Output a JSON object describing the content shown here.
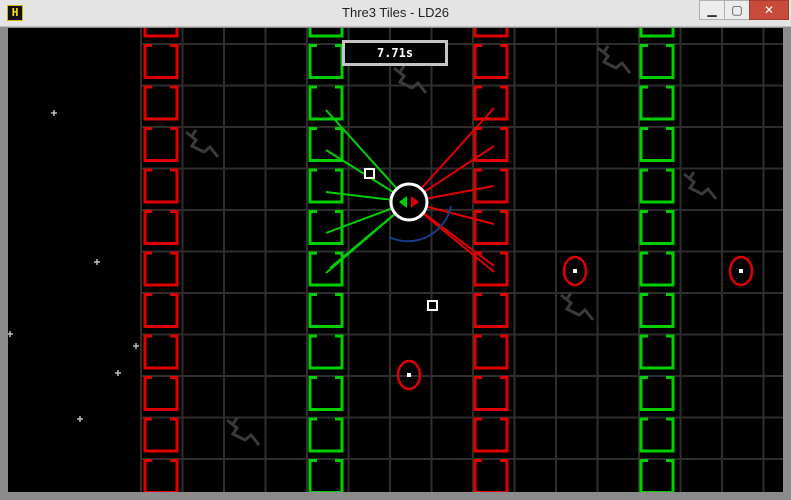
{
  "window": {
    "title": "Thre3 Tiles - LD26",
    "icon": "game-logo-icon",
    "icon_glyph": "H",
    "minimize_glyph": "▁",
    "maximize_glyph": "▢",
    "close_glyph": "✕"
  },
  "hud": {
    "timer": "7.71s"
  },
  "colors": {
    "background": "#000000",
    "grid": "#2e2e2e",
    "red_wall": "#e00000",
    "green_wall": "#00d000",
    "player": "#ffffff",
    "aim_arc": "#1a3a8a",
    "enemy_ring": "#e00000",
    "pickup": "#ffffff",
    "debris": "#3a3a3a",
    "timer_border": "#c4c4c4"
  },
  "columns": [
    {
      "name": "red-tile-column",
      "color": "red"
    },
    {
      "name": "green-tile-column",
      "color": "green"
    },
    {
      "name": "red-tile-column",
      "color": "red"
    },
    {
      "name": "green-tile-column",
      "color": "green"
    }
  ],
  "player": {
    "name": "player-reticle"
  },
  "laser_groups": [
    {
      "color": "green",
      "count": 6
    },
    {
      "color": "red",
      "count": 6
    }
  ],
  "enemies": [
    {
      "name": "enemy-red-ring"
    },
    {
      "name": "enemy-red-ring"
    },
    {
      "name": "enemy-red-ring"
    }
  ],
  "pickups": [
    {
      "name": "square-pickup"
    },
    {
      "name": "square-pickup"
    }
  ],
  "stars": 6,
  "debris_pieces": 6
}
